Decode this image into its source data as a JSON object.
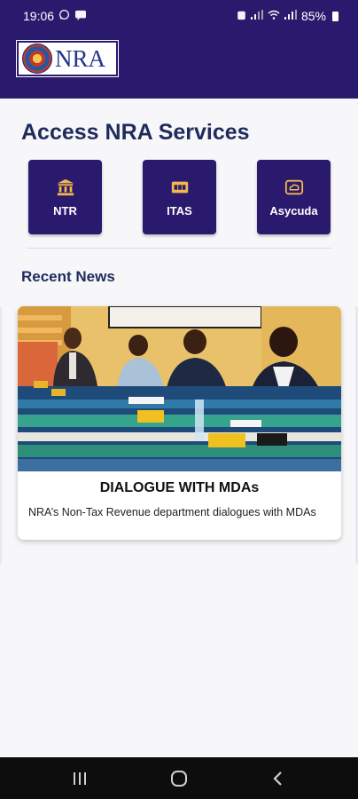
{
  "status_bar": {
    "time": "19:06",
    "battery": "85%",
    "left_icons": [
      "whatsapp-icon",
      "messaging-icon"
    ],
    "right_icons": [
      "alarm-icon",
      "signal-icon",
      "wifi-icon",
      "signal-icon"
    ]
  },
  "header": {
    "logo_text": "NRA"
  },
  "services": {
    "title": "Access NRA Services",
    "items": [
      {
        "label": "NTR",
        "icon": "bank-icon"
      },
      {
        "label": "ITAS",
        "icon": "card-icon"
      },
      {
        "label": "Asycuda",
        "icon": "cloud-icon"
      }
    ]
  },
  "news": {
    "title": "Recent News",
    "items": [
      {
        "heading": "DIALOGUE WITH MDAs",
        "description": "NRA’s Non-Tax Revenue department dialogues with MDAs"
      }
    ]
  },
  "colors": {
    "primary": "#2a1a6e",
    "icon_gold": "#f2b84b",
    "heading_text": "#1f2b5c",
    "background": "#f7f7f9"
  },
  "nav_bar": {
    "buttons": [
      "recents-icon",
      "home-icon",
      "back-icon"
    ]
  }
}
